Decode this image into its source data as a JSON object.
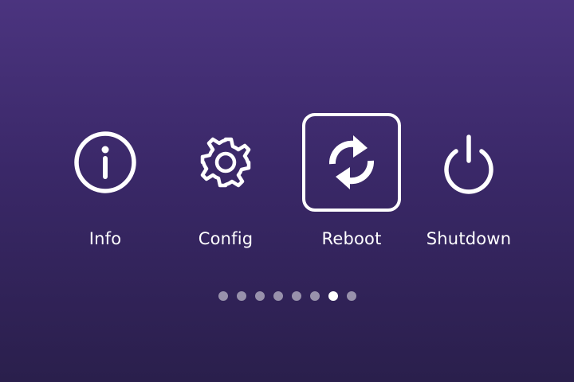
{
  "menu": {
    "items": [
      {
        "label": "Info",
        "icon": "info-icon"
      },
      {
        "label": "Config",
        "icon": "gear-icon"
      },
      {
        "label": "Reboot",
        "icon": "refresh-icon",
        "selected": true
      },
      {
        "label": "Shutdown",
        "icon": "power-icon"
      }
    ],
    "selected_index": 2
  },
  "pager": {
    "total_pages": 8,
    "current_page": 7
  },
  "colors": {
    "background_top": "#4b347f",
    "background_bottom": "#2a1f4c",
    "foreground": "#ffffff",
    "inactive_dot": "#a89cc0"
  }
}
